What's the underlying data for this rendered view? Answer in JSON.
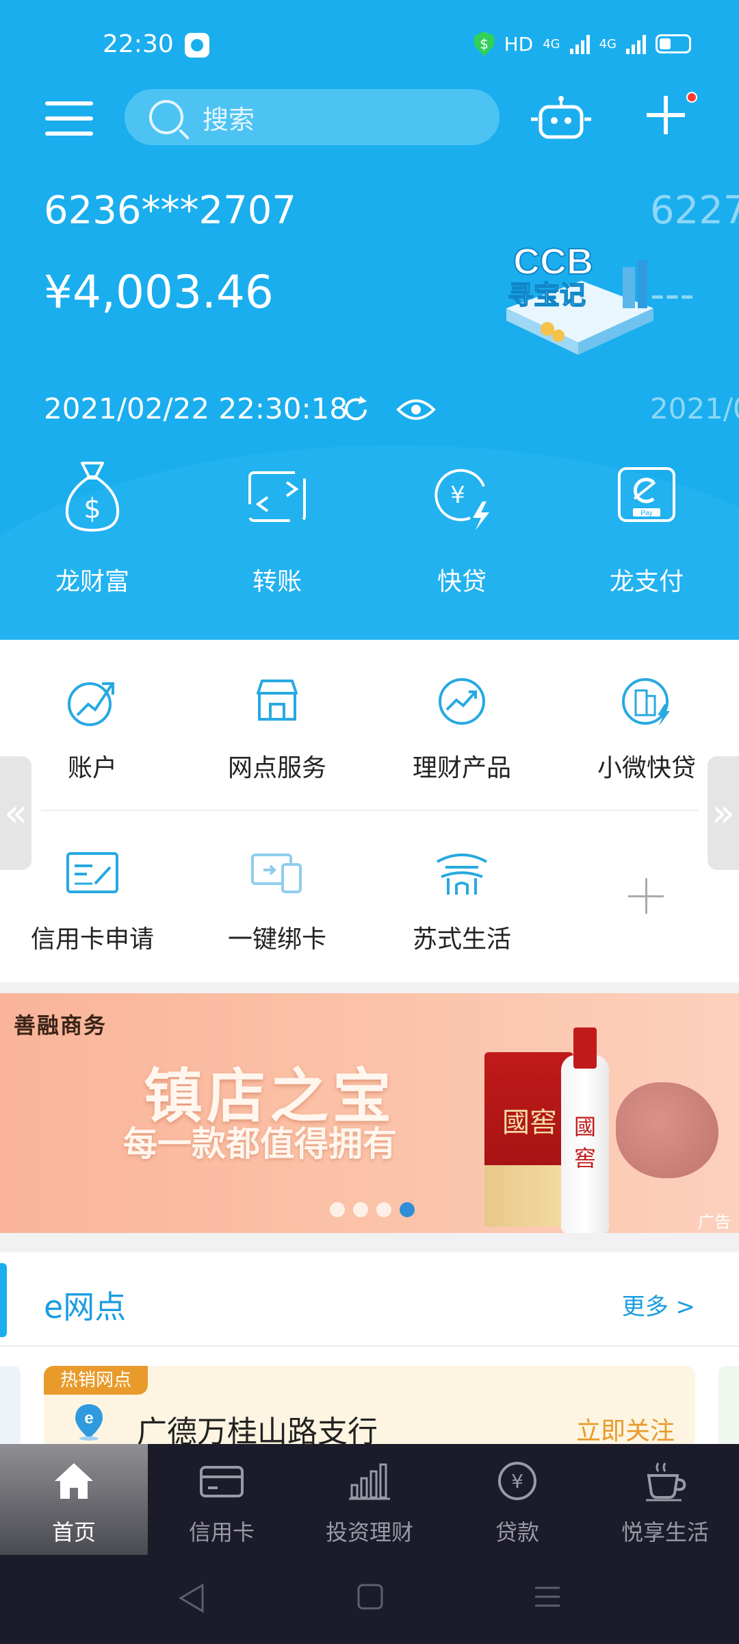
{
  "status_bar": {
    "time": "22:30",
    "hd_label": "HD",
    "net1": "4G",
    "net2": "4G"
  },
  "header": {
    "search_placeholder": "搜索"
  },
  "account": {
    "card_number": "6236***2707",
    "balance": "¥4,003.46",
    "updated_at": "2021/02/22 22:30:18",
    "next_card_number": "6227*",
    "next_balance": "---",
    "next_updated_at": "2021/0",
    "promo_text": "CCB寻宝记"
  },
  "quick_actions": [
    {
      "label": "龙财富",
      "icon": "money-bag-icon"
    },
    {
      "label": "转账",
      "icon": "transfer-icon"
    },
    {
      "label": "快贷",
      "icon": "quick-loan-icon"
    },
    {
      "label": "龙支付",
      "icon": "pay-icon"
    }
  ],
  "services_row1": [
    {
      "label": "账户",
      "icon": "account-growth-icon"
    },
    {
      "label": "网点服务",
      "icon": "branch-store-icon"
    },
    {
      "label": "理财产品",
      "icon": "wealth-product-icon"
    },
    {
      "label": "小微快贷",
      "icon": "small-business-loan-icon"
    }
  ],
  "services_row2": [
    {
      "label": "信用卡申请",
      "icon": "credit-card-apply-icon"
    },
    {
      "label": "一键绑卡",
      "icon": "bind-card-icon"
    },
    {
      "label": "苏式生活",
      "icon": "suzhou-pavilion-icon"
    },
    {
      "label": "",
      "icon": "add-icon"
    }
  ],
  "banner": {
    "brand": "善融商务",
    "headline": "镇店之宝",
    "subline": "每一款都值得拥有",
    "product_text": "國窖",
    "ad_label": "广告",
    "slide_count": 4,
    "active_slide": 4
  },
  "e_branch": {
    "title": "e网点",
    "more_label": "更多 >",
    "tag": "热销网点",
    "branch_name": "广德万桂山路支行",
    "follow_label": "立即关注"
  },
  "tabbar": [
    {
      "label": "首页",
      "icon": "home-icon",
      "active": true
    },
    {
      "label": "信用卡",
      "icon": "credit-card-icon",
      "active": false
    },
    {
      "label": "投资理财",
      "icon": "bar-chart-icon",
      "active": false
    },
    {
      "label": "贷款",
      "icon": "yuan-coin-icon",
      "active": false
    },
    {
      "label": "悦享生活",
      "icon": "coffee-cup-icon",
      "active": false
    }
  ],
  "colors": {
    "primary_blue": "#1aaeee",
    "accent_orange": "#e89a2a",
    "tabbar_bg": "#1c1b29"
  }
}
